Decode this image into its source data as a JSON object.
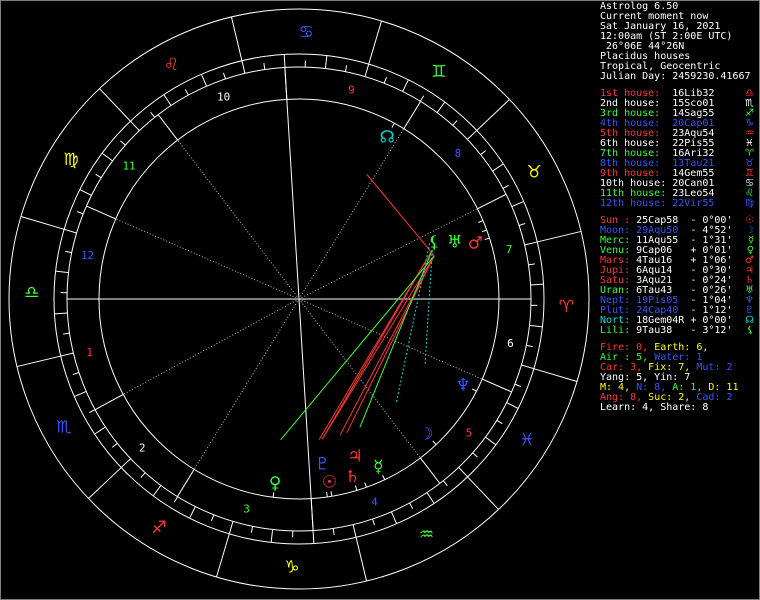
{
  "app_title": "Astrolog 6.50",
  "header": [
    "Current moment now",
    "Sat January 16, 2021",
    "12:00am (ST 2:00E UTC)",
    " 26°06E 44°26N",
    "Placidus houses",
    "Tropical, Geocentric",
    "Julian Day: 2459230.41667"
  ],
  "houses": [
    {
      "label": "1st house:",
      "value": "16Lib32",
      "color": "#ff3333",
      "glyph": "♎"
    },
    {
      "label": "2nd house:",
      "value": "15Sco01",
      "color": "#ffffff",
      "glyph": "♏"
    },
    {
      "label": "3rd house:",
      "value": "14Sag55",
      "color": "#33ff33",
      "glyph": "♐"
    },
    {
      "label": "4th house:",
      "value": "20Cap01",
      "color": "#3355ff",
      "glyph": "♑"
    },
    {
      "label": "5th house:",
      "value": "23Aqu54",
      "color": "#ff3333",
      "glyph": "♒"
    },
    {
      "label": "6th house:",
      "value": "22Pis55",
      "color": "#ffffff",
      "glyph": "♓"
    },
    {
      "label": "7th house:",
      "value": "16Ari32",
      "color": "#33ff33",
      "glyph": "♈"
    },
    {
      "label": "8th house:",
      "value": "13Tau21",
      "color": "#3355ff",
      "glyph": "♉"
    },
    {
      "label": "9th house:",
      "value": "14Gem55",
      "color": "#ff3333",
      "glyph": "♊"
    },
    {
      "label": "10th house:",
      "value": "20Can01",
      "color": "#ffffff",
      "glyph": "♋"
    },
    {
      "label": "11th house:",
      "value": "23Leo54",
      "color": "#33ff33",
      "glyph": "♌"
    },
    {
      "label": "12th house:",
      "value": "22Vir55",
      "color": "#3355ff",
      "glyph": "♍"
    }
  ],
  "planets": [
    {
      "name": "Sun :",
      "pos": "25Cap58",
      "lat": "- 0°00'",
      "color": "#ff3333",
      "glyph": "☉"
    },
    {
      "name": "Moon:",
      "pos": "29Aqu50",
      "lat": "- 4°52'",
      "color": "#3355ff",
      "glyph": "☽"
    },
    {
      "name": "Merc:",
      "pos": "11Aqu55",
      "lat": "- 1°31'",
      "color": "#33ff33",
      "glyph": "☿"
    },
    {
      "name": "Venu:",
      "pos": "9Cap06",
      "lat": "+ 0°01'",
      "color": "#33ff33",
      "glyph": "♀"
    },
    {
      "name": "Mars:",
      "pos": "4Tau16",
      "lat": "+ 1°06'",
      "color": "#ff3333",
      "glyph": "♂"
    },
    {
      "name": "Jupi:",
      "pos": "6Aqu14",
      "lat": "- 0°30'",
      "color": "#ff3333",
      "glyph": "♃"
    },
    {
      "name": "Satu:",
      "pos": "3Aqu21",
      "lat": "- 0°24'",
      "color": "#ff3333",
      "glyph": "♄"
    },
    {
      "name": "Uran:",
      "pos": "6Tau43",
      "lat": "- 0°26'",
      "color": "#33ff33",
      "glyph": "♅"
    },
    {
      "name": "Nept:",
      "pos": "19Pis05",
      "lat": "- 1°04'",
      "color": "#3355ff",
      "glyph": "♆"
    },
    {
      "name": "Plut:",
      "pos": "24Cap40",
      "lat": "- 1°12'",
      "color": "#3355ff",
      "glyph": "♇"
    },
    {
      "name": "Nort:",
      "pos": "18Gem04R",
      "lat": "+ 0°00'",
      "color": "#00dddd",
      "glyph": "☊"
    },
    {
      "name": "Lili:",
      "pos": "9Tau38",
      "lat": "- 3°12'",
      "color": "#33ff33",
      "glyph": "⚸"
    }
  ],
  "elements": [
    [
      {
        "t": "Fire: 0, ",
        "c": "#ff3333"
      },
      {
        "t": "Earth: 6,",
        "c": "#ffff00"
      }
    ],
    [
      {
        "t": "Air : 5, ",
        "c": "#33ff33"
      },
      {
        "t": "Water: 1",
        "c": "#3355ff"
      }
    ],
    [
      {
        "t": "Car: 3, ",
        "c": "#ff3333"
      },
      {
        "t": "Fix: 7, ",
        "c": "#ffff00"
      },
      {
        "t": "Mut: 2",
        "c": "#3355ff"
      }
    ],
    [
      {
        "t": "Yang: 5, Yin: 7",
        "c": "#ffffff"
      }
    ],
    [
      {
        "t": "M: 4, ",
        "c": "#ffff00"
      },
      {
        "t": "N: 8, ",
        "c": "#3355ff"
      },
      {
        "t": "A: 1, ",
        "c": "#33ff33"
      },
      {
        "t": "D: 11",
        "c": "#ffff00"
      }
    ],
    [
      {
        "t": "Ang: 8, ",
        "c": "#ff3333"
      },
      {
        "t": "Suc: 2, ",
        "c": "#ffff00"
      },
      {
        "t": "Cad: 2",
        "c": "#3355ff"
      }
    ],
    [
      {
        "t": "Learn: 4, Share: 8",
        "c": "#ffffff"
      }
    ]
  ],
  "wheel": {
    "ascendant_lon": 196.53,
    "cusps": [
      196.53,
      225.02,
      254.92,
      290.02,
      323.9,
      352.92,
      16.53,
      43.35,
      74.92,
      110.02,
      143.9,
      172.92
    ],
    "house_numbers": [
      "1",
      "2",
      "3",
      "4",
      "5",
      "6",
      "7",
      "8",
      "9",
      "10",
      "11",
      "12"
    ],
    "house_number_colors": [
      "#ff3333",
      "#ffffff",
      "#33ff33",
      "#3355ff",
      "#ff3333",
      "#ffffff",
      "#33ff33",
      "#3355ff",
      "#ff3333",
      "#ffffff",
      "#33ff33",
      "#3355ff"
    ],
    "signs": [
      {
        "glyph": "♈",
        "color": "#ff3333"
      },
      {
        "glyph": "♉",
        "color": "#ffff00"
      },
      {
        "glyph": "♊",
        "color": "#33ff33"
      },
      {
        "glyph": "♋",
        "color": "#3355ff"
      },
      {
        "glyph": "♌",
        "color": "#ff3333"
      },
      {
        "glyph": "♍",
        "color": "#ffff00"
      },
      {
        "glyph": "♎",
        "color": "#33ff33"
      },
      {
        "glyph": "♏",
        "color": "#3355ff"
      },
      {
        "glyph": "♐",
        "color": "#ff3333"
      },
      {
        "glyph": "♑",
        "color": "#ffff00"
      },
      {
        "glyph": "♒",
        "color": "#33ff33"
      },
      {
        "glyph": "♓",
        "color": "#3355ff"
      }
    ],
    "planet_lons": [
      {
        "glyph": "☉",
        "lon": 295.97,
        "color": "#ff3333"
      },
      {
        "glyph": "☽",
        "lon": 329.83,
        "color": "#3355ff"
      },
      {
        "glyph": "☿",
        "lon": 311.92,
        "color": "#33ff33"
      },
      {
        "glyph": "♀",
        "lon": 279.1,
        "color": "#33ff33"
      },
      {
        "glyph": "♂",
        "lon": 34.27,
        "color": "#ff3333"
      },
      {
        "glyph": "♃",
        "lon": 306.23,
        "color": "#ff3333"
      },
      {
        "glyph": "♄",
        "lon": 303.35,
        "color": "#ff3333"
      },
      {
        "glyph": "♅",
        "lon": 36.72,
        "color": "#33ff33"
      },
      {
        "glyph": "♆",
        "lon": 349.08,
        "color": "#3355ff"
      },
      {
        "glyph": "♇",
        "lon": 294.67,
        "color": "#3355ff"
      },
      {
        "glyph": "☊",
        "lon": 78.07,
        "color": "#00dddd"
      },
      {
        "glyph": "⚸",
        "lon": 39.63,
        "color": "#33ff33"
      }
    ],
    "aspects": [
      {
        "a": "♂",
        "b": "☉",
        "color": "#ff3333"
      },
      {
        "a": "♂",
        "b": "♃",
        "color": "#ff3333"
      },
      {
        "a": "♂",
        "b": "♄",
        "color": "#ff3333"
      },
      {
        "a": "♅",
        "b": "☉",
        "color": "#ff3333"
      },
      {
        "a": "♅",
        "b": "♇",
        "color": "#ff3333"
      },
      {
        "a": "♂",
        "b": "♀",
        "color": "#33ff33"
      },
      {
        "a": "♅",
        "b": "☿",
        "color": "#33ff33"
      },
      {
        "a": "☊",
        "b": "♂",
        "color": "#ff3333"
      },
      {
        "a": "⚸",
        "b": "☽",
        "color": "#00dddd"
      },
      {
        "a": "♅",
        "b": "♆",
        "color": "#00dddd"
      }
    ]
  }
}
